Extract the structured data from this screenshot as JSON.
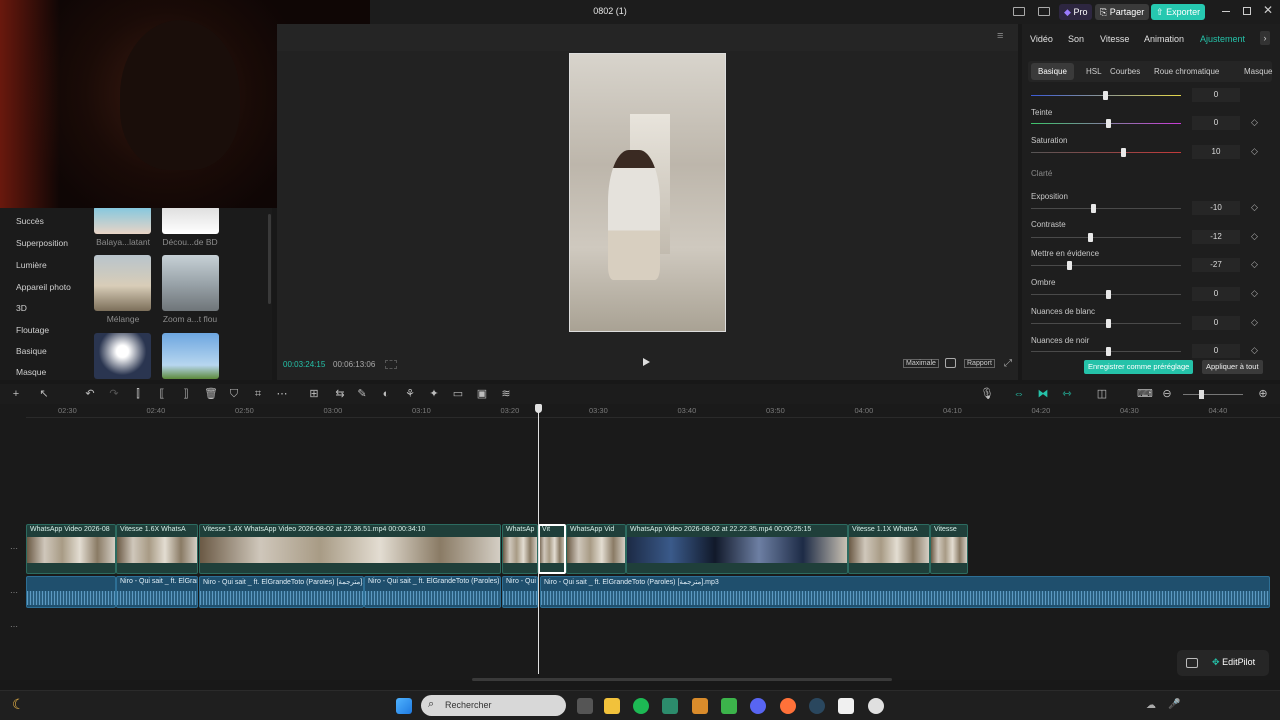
{
  "titlebar": {
    "title": "0802 (1)",
    "pro": "Pro",
    "share": "Partager",
    "export": "Exporter"
  },
  "left": {
    "categories": [
      "Succès",
      "Superposition",
      "Lumière",
      "Appareil photo",
      "3D",
      "Floutage",
      "Basique",
      "Masque"
    ],
    "thumbs": [
      {
        "label": "Balaya...latant"
      },
      {
        "label": "Décou...de BD"
      },
      {
        "label": "Mélange"
      },
      {
        "label": "Zoom a...t flou"
      }
    ]
  },
  "preview": {
    "current_time": "00:03:24:15",
    "total_time": "00:06:13:06",
    "maximale": "Maximale",
    "rapport": "Rapport"
  },
  "right": {
    "tabs": [
      "Vidéo",
      "Son",
      "Vitesse",
      "Animation",
      "Ajustement"
    ],
    "active_tab": "Ajustement",
    "subtabs": [
      "Basique",
      "HSL",
      "Courbes",
      "Roue chromatique",
      "Masque"
    ],
    "section_clarte": "Clarté",
    "sliders": [
      {
        "label": "Teinte",
        "value": "0",
        "knob": 0.5
      },
      {
        "label": "Saturation",
        "value": "10",
        "knob": 0.6
      },
      {
        "label": "Exposition",
        "value": "-10",
        "knob": 0.4
      },
      {
        "label": "Contraste",
        "value": "-12",
        "knob": 0.38
      },
      {
        "label": "Mettre en évidence",
        "value": "-27",
        "knob": 0.24
      },
      {
        "label": "Ombre",
        "value": "0",
        "knob": 0.5
      },
      {
        "label": "Nuances de blanc",
        "value": "0",
        "knob": 0.5
      },
      {
        "label": "Nuances de noir",
        "value": "0",
        "knob": 0.5
      }
    ],
    "top_slider_value": "0",
    "save_preset": "Enregistrer comme préréglage",
    "apply_all": "Appliquer à tout"
  },
  "timeline": {
    "ticks": [
      "02:30",
      "02:40",
      "02:50",
      "03:00",
      "03:10",
      "03:20",
      "03:30",
      "03:40",
      "03:50",
      "04:00",
      "04:10",
      "04:20",
      "04:30",
      "04:40"
    ],
    "video_clips": [
      {
        "label": "WhatsApp Video 2026-08"
      },
      {
        "label": "Vitesse 1.6X   WhatsA"
      },
      {
        "label": "Vitesse 1.4X   WhatsApp Video 2026-08-02 at 22.36.51.mp4   00:00:34:10"
      },
      {
        "label": "WhatsAp"
      },
      {
        "label": "Vit"
      },
      {
        "label": "WhatsApp Vid"
      },
      {
        "label": "WhatsApp Video 2026-08-02 at 22.22.35.mp4   00:00:25:15"
      },
      {
        "label": "Vitesse 1.1X   WhatsA"
      },
      {
        "label": "Vitesse"
      }
    ],
    "audio_clips": [
      {
        "label": ""
      },
      {
        "label": "Niro - Qui sait _ ft. ElGran"
      },
      {
        "label": "Niro - Qui sait _ ft. ElGrandeToto (Paroles) [مترجمة].mp"
      },
      {
        "label": "Niro - Qui sait _ ft. ElGrandeToto (Paroles) [!"
      },
      {
        "label": "Niro - Qui s"
      },
      {
        "label": "Niro - Qui sait _ ft. ElGrandeToto (Paroles) [مترجمة].mp3"
      }
    ],
    "editpilot": "EditPilot"
  },
  "taskbar": {
    "search_placeholder": "Rechercher"
  },
  "colors": {
    "accent": "#25c2a9",
    "pro": "#7b5cff",
    "export": "#26c8b0",
    "playhead": "#e0e0e0"
  }
}
